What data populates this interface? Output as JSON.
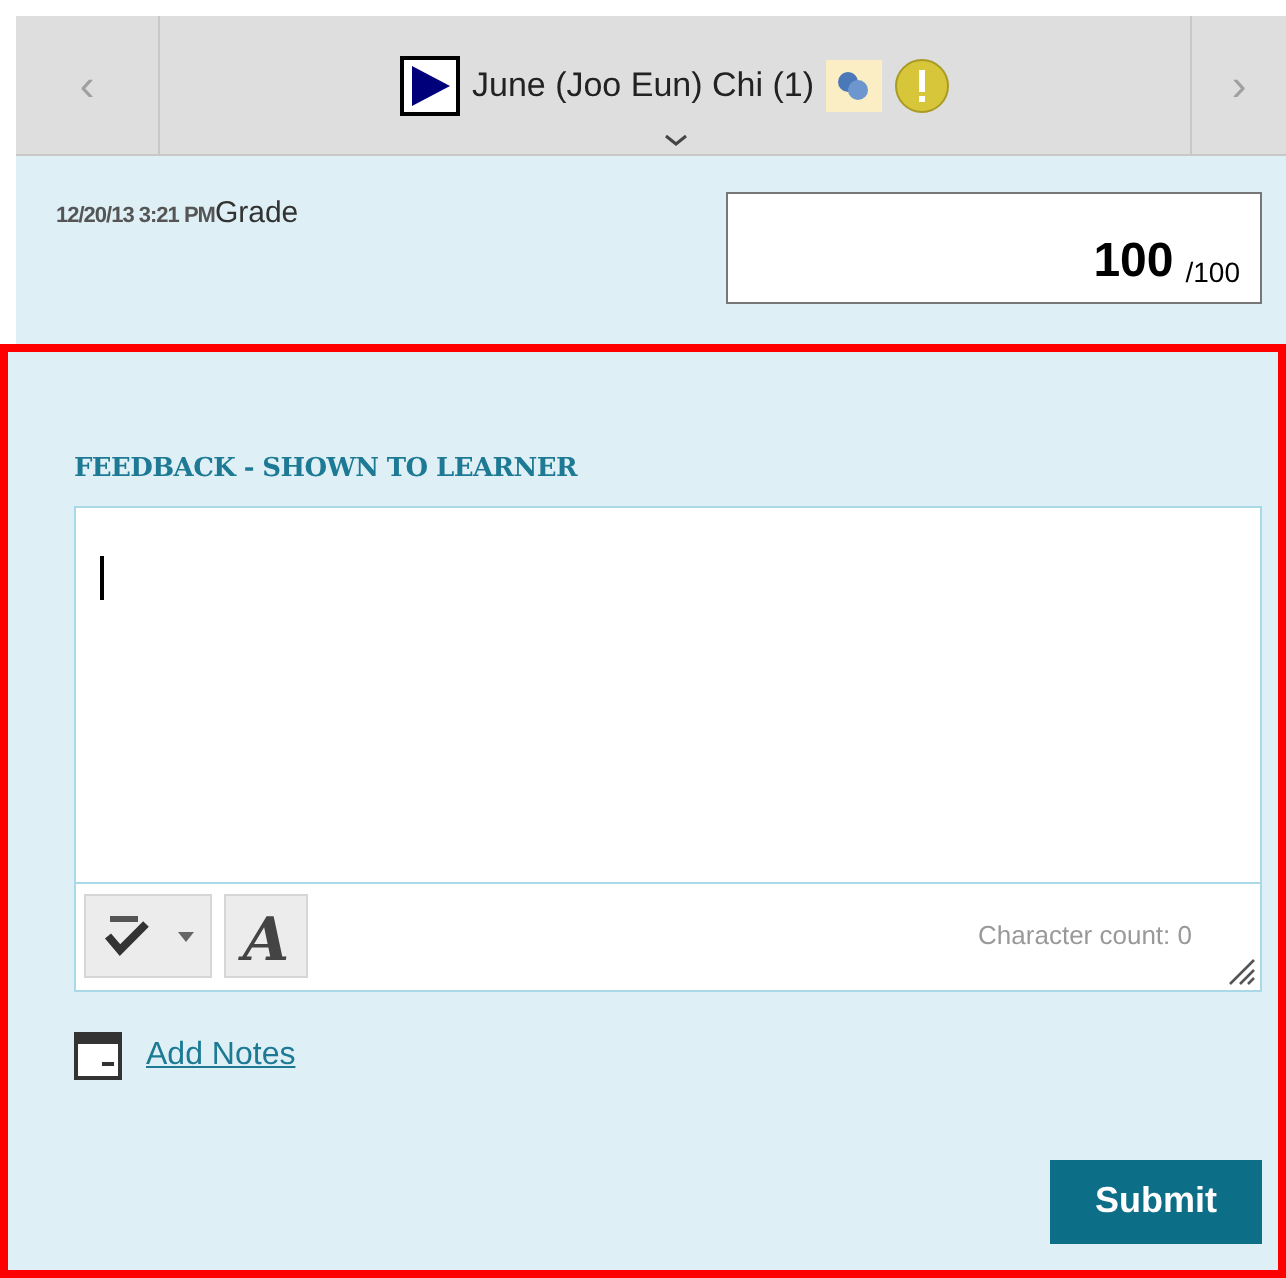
{
  "navigator": {
    "prev": "‹",
    "next": "›",
    "student": "June (Joo Eun) Chi (1)"
  },
  "grade": {
    "timestamp": "12/20/13 3:21 PM",
    "label": "Grade",
    "value": "100",
    "max": "/100"
  },
  "feedback": {
    "label": "FEEDBACK - SHOWN TO LEARNER",
    "font_button": "A",
    "character_count": "Character count: 0"
  },
  "add_notes": "Add Notes",
  "submit": "Submit"
}
